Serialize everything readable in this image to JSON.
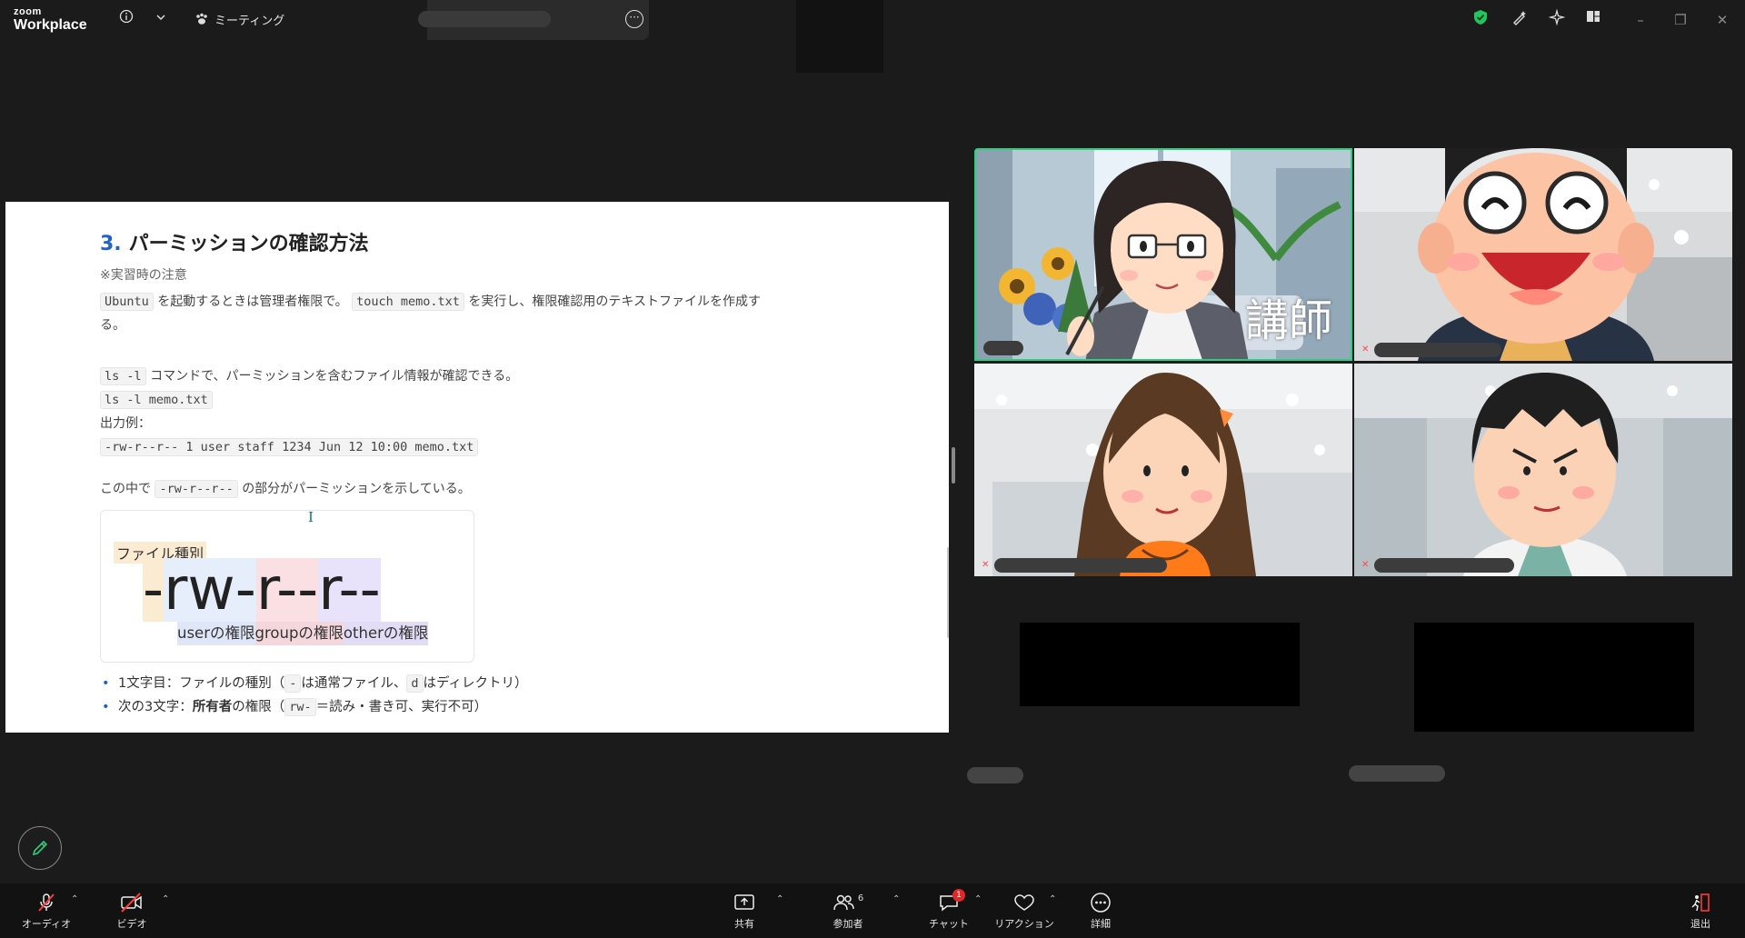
{
  "app": {
    "brand_line1": "zoom",
    "brand_line2": "Workplace",
    "meeting_label": "ミーティング"
  },
  "document": {
    "heading_number": "3.",
    "heading_text": "パーミッションの確認方法",
    "note": "※実習時の注意",
    "para1_code1": "Ubuntu",
    "para1_text1": "を起動するときは管理者権限で。",
    "para1_code2": "touch memo.txt",
    "para1_text2": "を実行し、権限確認用のテキストファイルを作成す",
    "para1_text3": "る。",
    "para2_code": "ls -l",
    "para2_text": "コマンドで、パーミッションを含むファイル情報が確認できる。",
    "cmd_example": "ls -l memo.txt",
    "output_label": "出力例：",
    "output_example": "-rw-r--r-- 1 user staff  1234 Jun 12 10:00 memo.txt",
    "para3_text1": "この中で",
    "para3_code": "-rw-r--r--",
    "para3_text2": "の部分がパーミッションを示している。",
    "diagram": {
      "file_type_label": "ファイル種別",
      "segments": [
        "-",
        "rw-",
        "r--",
        "r--"
      ],
      "user_label": "userの権限",
      "group_label": "groupの権限",
      "other_label": "otherの権限"
    },
    "bullet1_a": "1文字目：ファイルの種別（",
    "bullet1_code1": "-",
    "bullet1_b": "は通常ファイル、",
    "bullet1_code2": "d",
    "bullet1_c": "はディレクトリ）",
    "bullet2_a": "次の3文字：",
    "bullet2_b": "所有者",
    "bullet2_c": "の権限（",
    "bullet2_code": "rw-",
    "bullet2_d": "＝読み・書き可、実行不可）"
  },
  "participants": {
    "tile1_caption": "講師"
  },
  "toolbar": {
    "audio": "オーディオ",
    "video": "ビデオ",
    "share": "共有",
    "participants": "参加者",
    "participants_count": "6",
    "chat": "チャット",
    "chat_badge": "1",
    "reaction": "リアクション",
    "more": "詳細",
    "leave": "退出"
  }
}
